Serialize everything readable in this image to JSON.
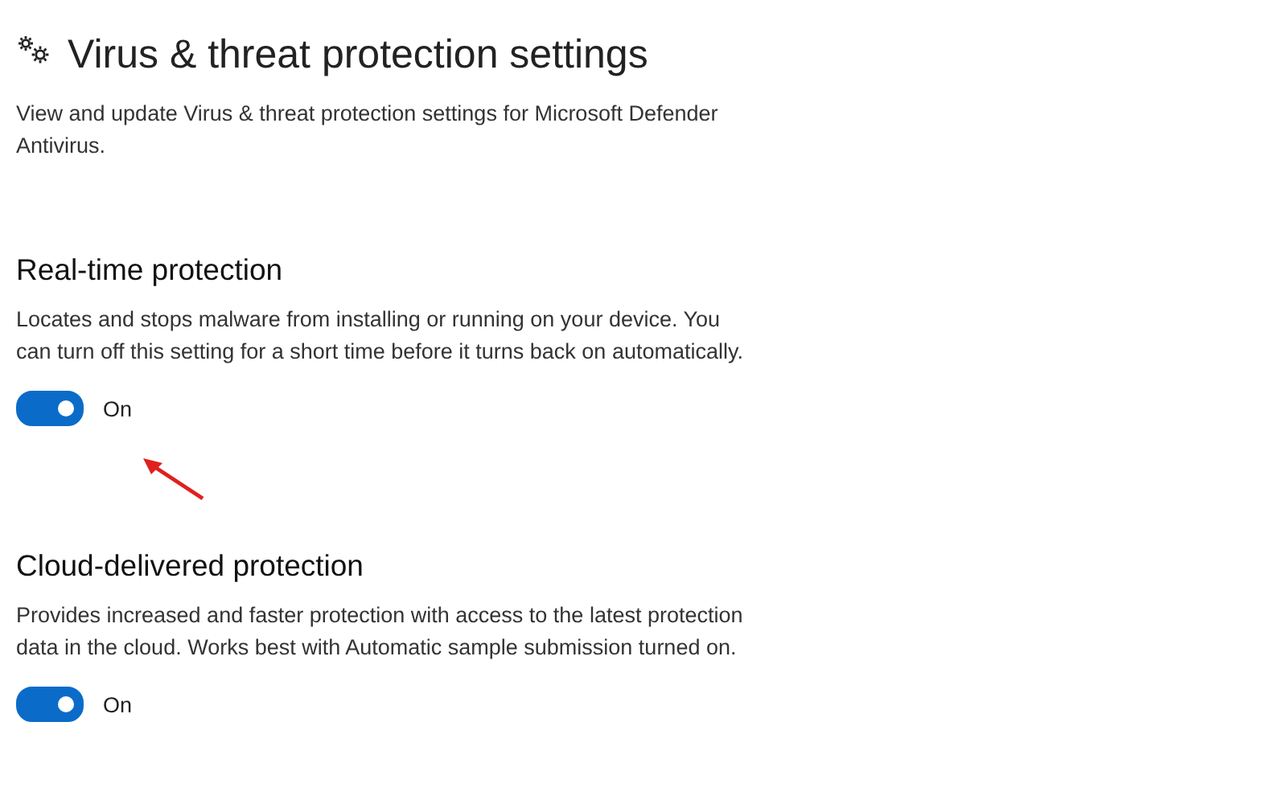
{
  "page": {
    "title": "Virus & threat protection settings",
    "description": "View and update Virus & threat protection settings for Microsoft Defender Antivirus."
  },
  "sections": [
    {
      "heading": "Real-time protection",
      "description": "Locates and stops malware from installing or running on your device. You can turn off this setting for a short time before it turns back on automatically.",
      "toggle": {
        "on": true,
        "label": "On"
      }
    },
    {
      "heading": "Cloud-delivered protection",
      "description": "Provides increased and faster protection with access to the latest protection data in the cloud. Works best with Automatic sample submission turned on.",
      "toggle": {
        "on": true,
        "label": "On"
      }
    }
  ],
  "annotation": {
    "kind": "arrow"
  }
}
